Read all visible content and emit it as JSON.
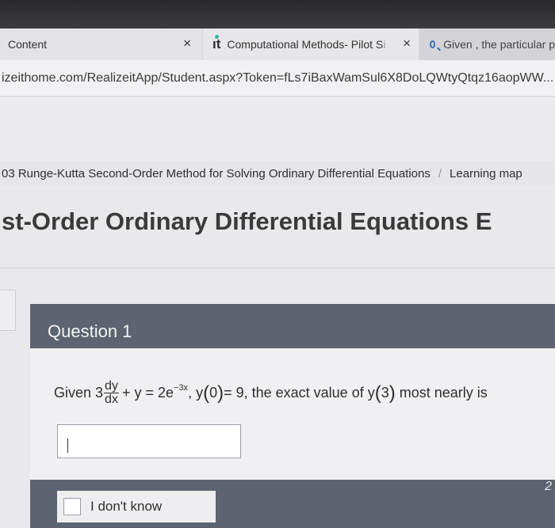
{
  "browser": {
    "tabs": [
      {
        "label": "Content",
        "close": "×"
      },
      {
        "label": "Computational Methods- Pilot S",
        "faded": "i",
        "close": "×"
      },
      {
        "label": "Given , the particular p"
      }
    ],
    "url": "izeithome.com/RealizeitApp/Student.aspx?Token=fLs7iBaxWamSul6X8DoLQWtyQtqz16aopWW..."
  },
  "breadcrumb": {
    "lesson": "03 Runge-Kutta Second-Order Method for Solving Ordinary Differential Equations",
    "separator": "/",
    "learning_map": "Learning map"
  },
  "page": {
    "title": "st-Order Ordinary Differential Equations E"
  },
  "question": {
    "heading": "Question 1",
    "prefix": "Given 3",
    "frac_num": "dy",
    "frac_den": "dx",
    "mid": "+ y = 2e",
    "exponent": "−3x",
    "cond": ", y",
    "cond_arg": "0",
    "cond_val": "= 9, the exact value of ",
    "target_fn": "y",
    "target_arg": "3",
    "suffix": " most nearly is",
    "answer_value": "",
    "dont_know": "I don't know",
    "page_indicator": "2"
  }
}
